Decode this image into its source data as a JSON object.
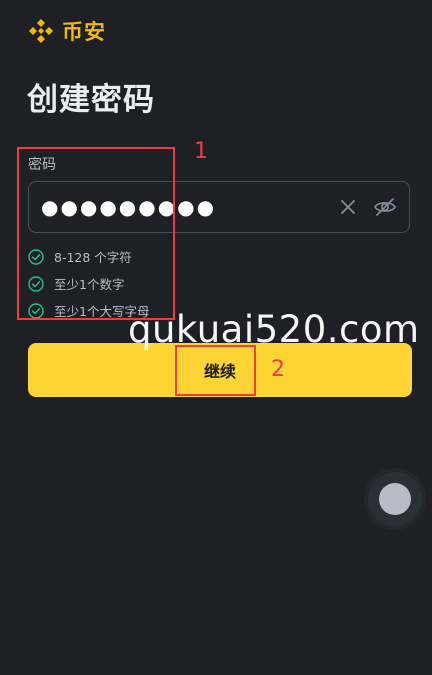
{
  "app": {
    "logo_text": "币安",
    "logo_icon": "binance-logo-icon",
    "brand_color": "#f0b90b"
  },
  "page": {
    "title": "创建密码"
  },
  "password": {
    "label": "密码",
    "value": "●●●●●●●●●",
    "clear_icon": "close-icon",
    "visibility_icon": "eye-off-icon"
  },
  "rules": [
    {
      "text": "8-128 个字符",
      "met": true
    },
    {
      "text": "至少1个数字",
      "met": true
    },
    {
      "text": "至少1个大写字母",
      "met": true
    }
  ],
  "actions": {
    "continue_label": "继续",
    "button_color": "#fcd535"
  },
  "annotations": {
    "box1_number": "1",
    "box2_number": "2",
    "color": "#f03c3c"
  },
  "watermark": "qukuai520.com",
  "floating_button_icon": "assistive-touch-icon"
}
